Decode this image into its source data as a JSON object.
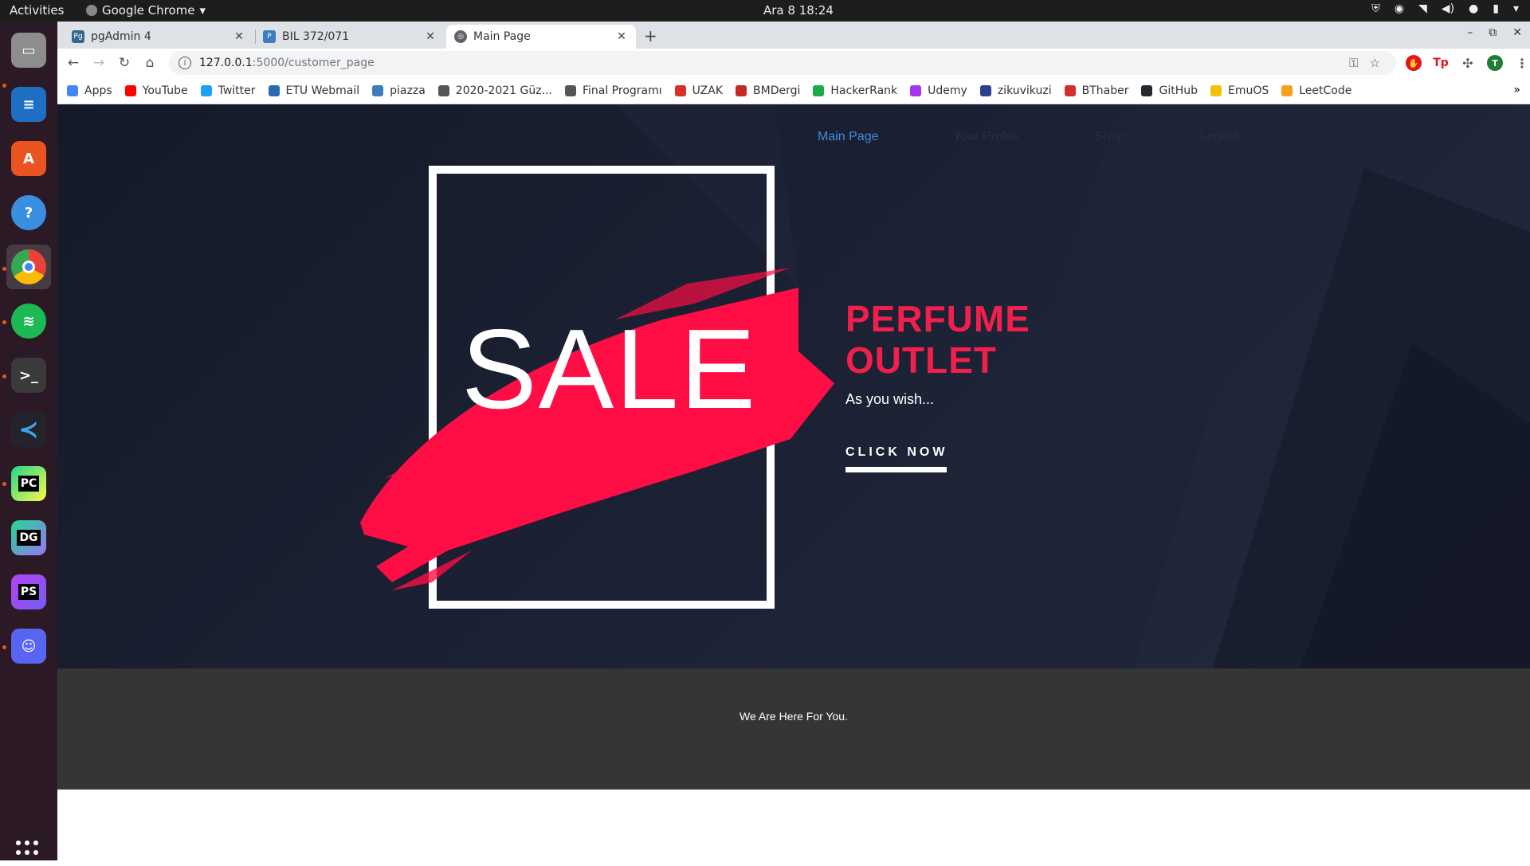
{
  "system": {
    "activities": "Activities",
    "app_menu": "Google Chrome",
    "clock": "Ara 8  18:24"
  },
  "tabs": [
    {
      "title": "pgAdmin 4",
      "favicon": "pgadmin-icon"
    },
    {
      "title": "BIL 372/071",
      "favicon": "piazza-icon"
    },
    {
      "title": "Main Page",
      "favicon": "globe-icon"
    }
  ],
  "address": {
    "host": "127.0.0.1",
    "path": ":5000/customer_page"
  },
  "bookmarks": [
    {
      "label": "Apps",
      "color": "#4285f4"
    },
    {
      "label": "YouTube",
      "color": "#ff0000"
    },
    {
      "label": "Twitter",
      "color": "#1da1f2"
    },
    {
      "label": "ETU Webmail",
      "color": "#2a6bb0"
    },
    {
      "label": "piazza",
      "color": "#3e7bbf"
    },
    {
      "label": "2020-2021 Güz...",
      "color": "#555555"
    },
    {
      "label": "Final Programı",
      "color": "#555555"
    },
    {
      "label": "UZAK",
      "color": "#d93025"
    },
    {
      "label": "BMDergi",
      "color": "#c62828"
    },
    {
      "label": "HackerRank",
      "color": "#1ba94c"
    },
    {
      "label": "Udemy",
      "color": "#a435f0"
    },
    {
      "label": "zikuvikuzi",
      "color": "#2c3e90"
    },
    {
      "label": "BThaber",
      "color": "#d32f2f"
    },
    {
      "label": "GitHub",
      "color": "#24292e"
    },
    {
      "label": "EmuOS",
      "color": "#f2c200"
    },
    {
      "label": "LeetCode",
      "color": "#f89f1b"
    }
  ],
  "bookmarks_more": "»",
  "page": {
    "nav": [
      "Main Page",
      "Your Profile",
      "Shop",
      "Logout"
    ],
    "sale": "SALE",
    "headline_line1": "PERFUME",
    "headline_line2": "OUTLET",
    "tagline": "As you wish...",
    "cta": "CLICK NOW",
    "footer": "We Are Here For You."
  },
  "colors": {
    "accent": "#f01f4b",
    "nav_active": "#3f8de0",
    "hero_bg": "#1b2133",
    "footer_bg": "#353535"
  }
}
